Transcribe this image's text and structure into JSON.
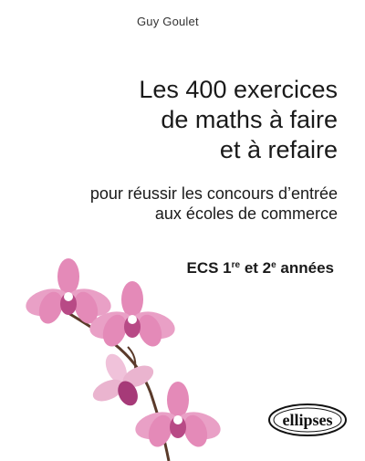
{
  "book": {
    "author": "Guy Goulet",
    "title_lines": [
      "Les 400 exercices",
      "de maths à faire",
      "et à refaire"
    ],
    "subtitle_lines": [
      "pour réussir les concours d’entrée",
      "aux écoles de commerce"
    ],
    "level": {
      "prefix": "ECS 1",
      "sup1": "re",
      "middle": " et 2",
      "sup2": "e",
      "suffix": " années"
    },
    "publisher": "ellipses"
  },
  "colors": {
    "petal": "#e48ab8",
    "petal_dark": "#c9588f",
    "stem": "#5a3a2a",
    "text": "#1a1a1a"
  },
  "icons": {
    "flowers": "orchid-illustration",
    "publisher": "ellipses-logo"
  }
}
